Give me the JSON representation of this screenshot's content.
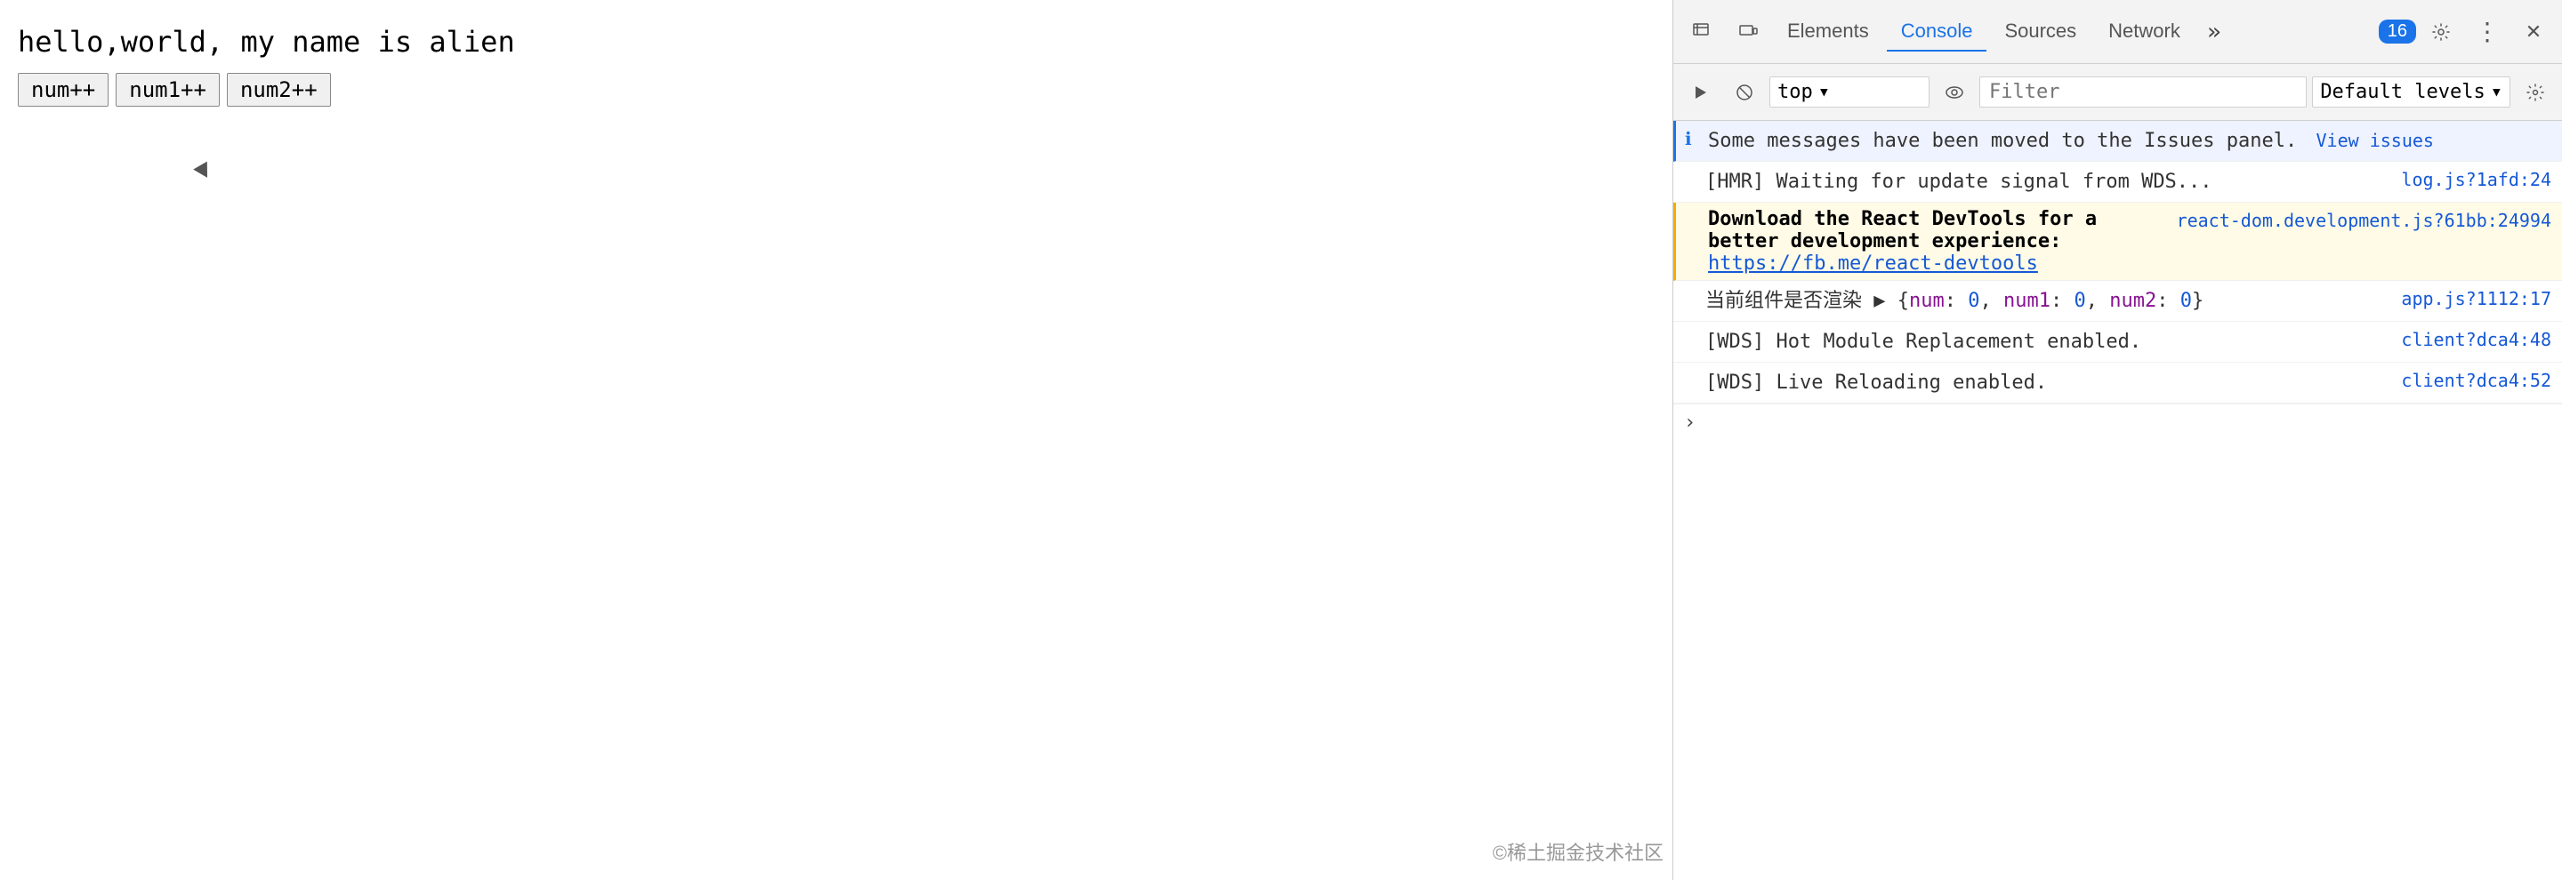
{
  "app": {
    "title": "hello,world, my name is alien",
    "buttons": [
      {
        "label": "num++"
      },
      {
        "label": "num1++"
      },
      {
        "label": "num2++"
      }
    ],
    "watermark": "©稀土掘金技术社区"
  },
  "devtools": {
    "toolbar": {
      "inspect_icon": "⊡",
      "device_icon": "▭",
      "tabs": [
        {
          "label": "Elements",
          "active": false
        },
        {
          "label": "Console",
          "active": true
        },
        {
          "label": "Sources",
          "active": false
        },
        {
          "label": "Network",
          "active": false
        }
      ],
      "more_icon": "»",
      "badge": "16",
      "settings_icon": "⚙",
      "more_vert_icon": "⋮",
      "close_icon": "✕"
    },
    "console_toolbar": {
      "play_icon": "▶",
      "ban_icon": "🚫",
      "context_label": "top",
      "dropdown_icon": "▾",
      "eye_icon": "👁",
      "filter_placeholder": "Filter",
      "level_label": "Default levels",
      "level_dropdown": "▾",
      "settings_icon": "⚙"
    },
    "messages": [
      {
        "type": "info",
        "icon": "ℹ",
        "content": "Some messages have been moved to the Issues panel.",
        "link_text": "View issues",
        "link_href": "#",
        "source": ""
      },
      {
        "type": "log",
        "icon": "",
        "content": "[HMR] Waiting for update signal from WDS...",
        "link_text": "",
        "source": "log.js?1afd:24"
      },
      {
        "type": "warning",
        "icon": "",
        "content_line1": "Download the React DevTools for a better development experience:",
        "link_text": "https://fb.me/react-devtools",
        "source": "react-dom.development.js?61bb:24994"
      },
      {
        "type": "log",
        "icon": "",
        "content_chinese": "当前组件是否渲染",
        "content_expand": "▶",
        "content_obj": "{num: 0, num1: 0, num2: 0}",
        "source": "app.js?1112:17"
      },
      {
        "type": "log",
        "icon": "",
        "content": "[WDS] Hot Module Replacement enabled.",
        "source": "client?dca4:48"
      },
      {
        "type": "log",
        "icon": "",
        "content": "[WDS] Live Reloading enabled.",
        "source": "client?dca4:52"
      }
    ],
    "prompt": {
      "chevron": "›"
    }
  }
}
